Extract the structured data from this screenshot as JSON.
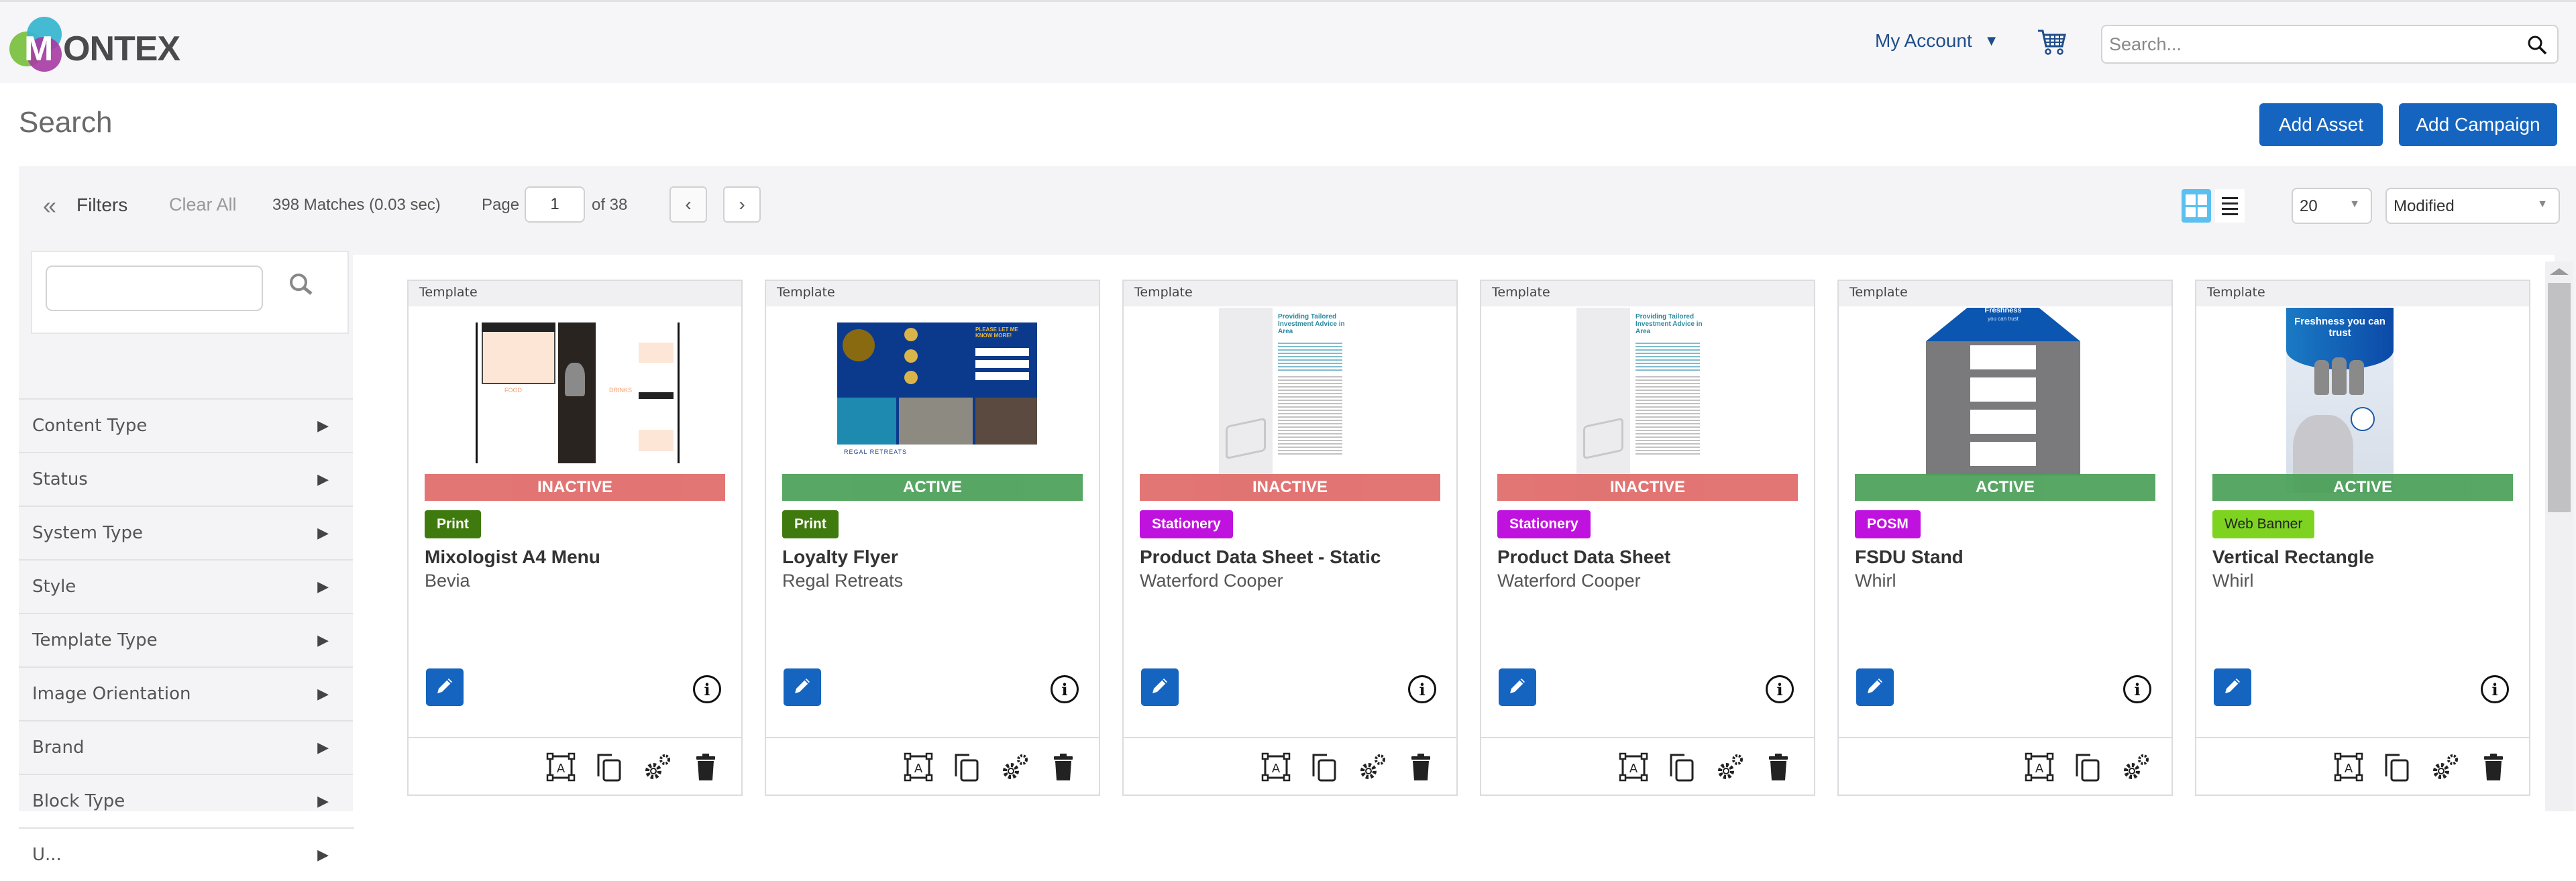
{
  "header": {
    "logo_initial": "M",
    "logo_rest": "ONTEX",
    "account_label": "My Account",
    "account_caret": "▼",
    "cart_icon": "shopping-cart-icon",
    "search_placeholder": "Search...",
    "search_value": ""
  },
  "page": {
    "title": "Search",
    "add_asset_label": "Add Asset",
    "add_campaign_label": "Add Campaign"
  },
  "toolbar": {
    "collapse_icon": "«",
    "filters_label": "Filters",
    "clear_all_label": "Clear All",
    "matches_text": "398 Matches (0.03 sec)",
    "page_label": "Page",
    "page_value": "1",
    "of_label": "of 38",
    "prev_icon": "‹",
    "next_icon": "›",
    "view_mode": "grid",
    "page_size": "20",
    "sort_by": "Modified",
    "dropdown_arrow": "▼"
  },
  "sidebar": {
    "search_value": "",
    "facets": [
      {
        "label": "Content Type"
      },
      {
        "label": "Status"
      },
      {
        "label": "System Type"
      },
      {
        "label": "Style"
      },
      {
        "label": "Template Type"
      },
      {
        "label": "Image Orientation"
      },
      {
        "label": "Brand"
      },
      {
        "label": "Block Type"
      },
      {
        "label": "U..."
      }
    ],
    "facet_arrow": "▶"
  },
  "colors": {
    "primary": "#1565c0",
    "inactive": "#e06a68",
    "active": "#4a9f57",
    "print": "#3f7a0f",
    "stationery": "#c012de",
    "posm": "#c012de",
    "web_banner": "#7ed321"
  },
  "cards": [
    {
      "header": "Template",
      "status": "INACTIVE",
      "badge": "Print",
      "title": "Mixologist A4 Menu",
      "brand": "Bevia",
      "thumbnail": "menu-thumbnail",
      "has_delete": true
    },
    {
      "header": "Template",
      "status": "ACTIVE",
      "badge": "Print",
      "title": "Loyalty Flyer",
      "brand": "Regal Retreats",
      "thumbnail": "flyer-thumbnail",
      "has_delete": true
    },
    {
      "header": "Template",
      "status": "INACTIVE",
      "badge": "Stationery",
      "title": "Product Data Sheet - Static",
      "brand": "Waterford Cooper",
      "thumbnail": "datasheet-thumbnail",
      "has_delete": true
    },
    {
      "header": "Template",
      "status": "INACTIVE",
      "badge": "Stationery",
      "title": "Product Data Sheet",
      "brand": "Waterford Cooper",
      "thumbnail": "datasheet-thumbnail",
      "has_delete": true
    },
    {
      "header": "Template",
      "status": "ACTIVE",
      "badge": "POSM",
      "title": "FSDU Stand",
      "brand": "Whirl",
      "thumbnail": "fsdu-thumbnail",
      "has_delete": false
    },
    {
      "header": "Template",
      "status": "ACTIVE",
      "badge": "Web Banner",
      "title": "Vertical Rectangle",
      "brand": "Whirl",
      "thumbnail": "banner-thumbnail",
      "has_delete": true
    }
  ],
  "thumb_text": {
    "menu_food": "FOOD",
    "menu_drinks": "DRINKS",
    "flyer_cta": "PLEASE LET ME KNOW MORE!",
    "flyer_brand": "REGAL RETREATS",
    "datasheet_heading": "Providing Tailored Investment Advice in Area",
    "fsdu_heading": "Freshness",
    "fsdu_sub": "you can trust",
    "banner_heading": "Freshness you can trust"
  }
}
